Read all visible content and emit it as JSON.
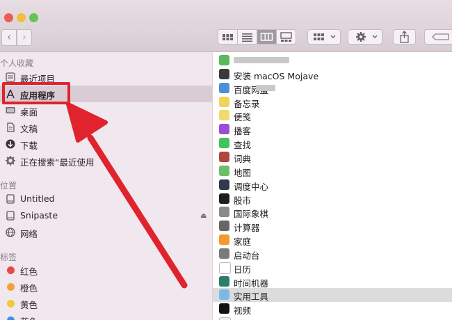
{
  "window": {
    "accent": "#e0232c",
    "selection_color": "#d9ccd4"
  },
  "toolbar": {
    "back_icon": "chevron-left-icon",
    "forward_icon": "chevron-right-icon",
    "views": [
      "icon-view",
      "list-view",
      "column-view",
      "gallery-view"
    ],
    "active_view": "column-view",
    "group_icon": "group-grid-icon",
    "action_icon": "gear-icon",
    "share_icon": "share-icon",
    "tag_icon": "tag-icon"
  },
  "sidebar": {
    "favorites_header": "个人收藏",
    "favorites": [
      {
        "label": "最近项目",
        "icon": "clock-icon"
      },
      {
        "label": "应用程序",
        "icon": "applications-icon",
        "selected": true
      },
      {
        "label": "桌面",
        "icon": "desktop-icon"
      },
      {
        "label": "文稿",
        "icon": "document-icon"
      },
      {
        "label": "下载",
        "icon": "download-icon"
      },
      {
        "label": "正在搜索“最近使用",
        "icon": "gear-search-icon"
      }
    ],
    "locations_header": "位置",
    "locations": [
      {
        "label": "Untitled",
        "icon": "disk-icon"
      },
      {
        "label": "Snipaste",
        "icon": "disk-icon",
        "eject": "⏏"
      },
      {
        "label": "网络",
        "icon": "network-icon"
      }
    ],
    "tags_header": "标签",
    "tags": [
      {
        "label": "红色",
        "color": "#e8474c"
      },
      {
        "label": "橙色",
        "color": "#f2a23c"
      },
      {
        "label": "黄色",
        "color": "#f0c93a"
      },
      {
        "label": "蓝色",
        "color": "#3f8de8"
      }
    ]
  },
  "files": [
    {
      "label": "",
      "icon": "app-green-icon",
      "color": "#5cb85c",
      "blurred": true
    },
    {
      "label": "安装 macOS Mojave",
      "icon": "installer-icon",
      "color": "#3a3a3a"
    },
    {
      "label": "百度网盘",
      "icon": "cloud-app-icon",
      "color": "#4d8fd6",
      "blurred": true
    },
    {
      "label": "备忘录",
      "icon": "notes-icon",
      "color": "#f2d35b"
    },
    {
      "label": "便笺",
      "icon": "stickies-icon",
      "color": "#f5d96b"
    },
    {
      "label": "播客",
      "icon": "podcast-icon",
      "color": "#9b4fd4"
    },
    {
      "label": "查找",
      "icon": "findmy-icon",
      "color": "#45c15e"
    },
    {
      "label": "词典",
      "icon": "dictionary-icon",
      "color": "#b2453c"
    },
    {
      "label": "地图",
      "icon": "maps-icon",
      "color": "#6cbf6a"
    },
    {
      "label": "调度中心",
      "icon": "mission-control-icon",
      "color": "#2f3b4b"
    },
    {
      "label": "股市",
      "icon": "stocks-icon",
      "color": "#1d1d1d"
    },
    {
      "label": "国际象棋",
      "icon": "chess-icon",
      "color": "#8a8a8a"
    },
    {
      "label": "计算器",
      "icon": "calculator-icon",
      "color": "#666666"
    },
    {
      "label": "家庭",
      "icon": "home-icon",
      "color": "#f29a2e"
    },
    {
      "label": "启动台",
      "icon": "launchpad-icon",
      "color": "#7a7a7a"
    },
    {
      "label": "日历",
      "icon": "calendar-icon",
      "color": "#ffffff"
    },
    {
      "label": "时间机器",
      "icon": "time-machine-icon",
      "color": "#2d7d6e"
    },
    {
      "label": "实用工具",
      "icon": "utilities-folder-icon",
      "color": "#7cb8e6",
      "selected": true
    },
    {
      "label": "视频",
      "icon": "tv-icon",
      "color": "#111111"
    },
    {
      "label": "提醒事项",
      "icon": "reminders-icon",
      "color": "#eeeeee"
    }
  ],
  "annotation": {
    "highlight_target": "应用程序",
    "arrow_icon": "red-arrow-icon"
  }
}
